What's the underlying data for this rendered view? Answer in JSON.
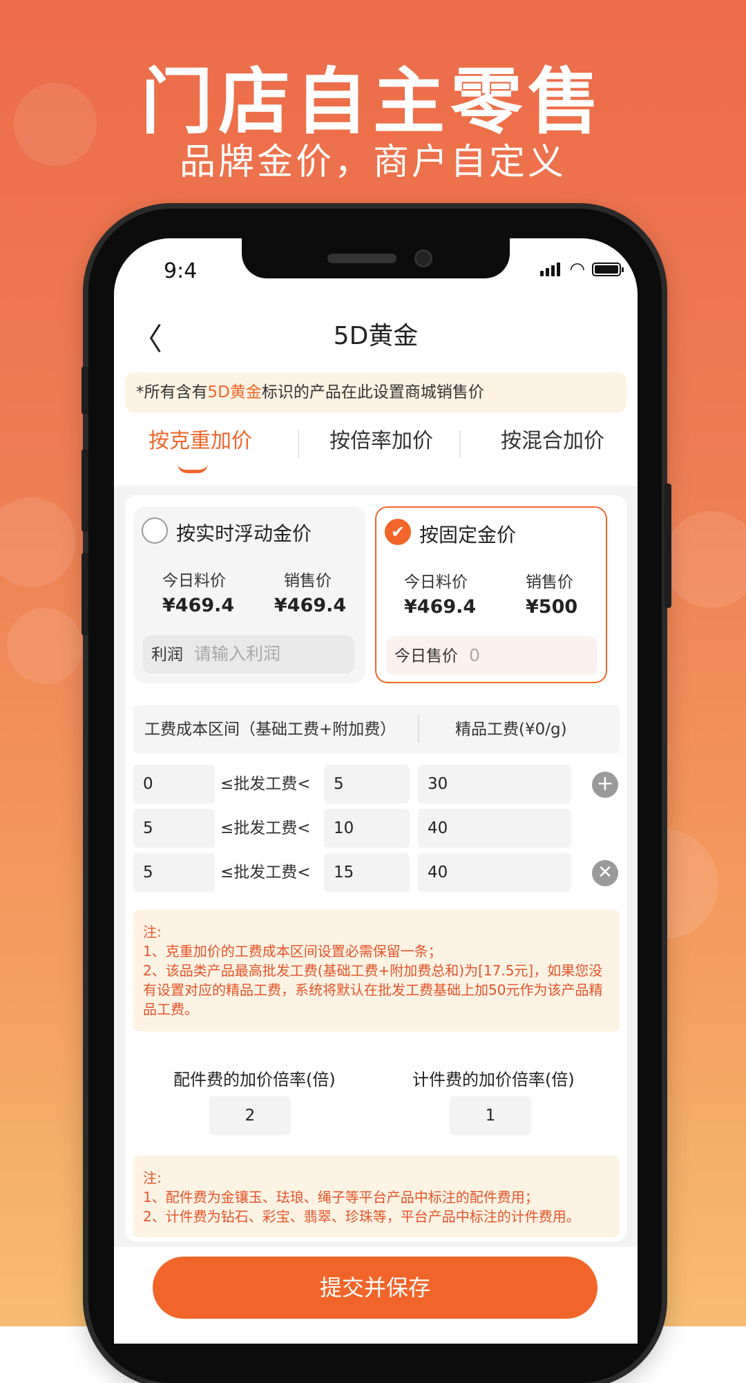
{
  "hero": {
    "title": "门店自主零售",
    "subtitle": "品牌金价，商户自定义"
  },
  "status_bar": {
    "time": "9:4"
  },
  "nav": {
    "title": "5D黄金"
  },
  "notice": {
    "prefix": "*所有含有",
    "highlight": "5D黄金",
    "suffix": "标识的产品在此设置商城销售价"
  },
  "tabs": [
    {
      "label": "按克重加价",
      "active": true
    },
    {
      "label": "按倍率加价",
      "active": false
    },
    {
      "label": "按混合加价",
      "active": false
    }
  ],
  "modes": {
    "floating": {
      "title": "按实时浮动金价",
      "checked": false,
      "material_label": "今日料价",
      "material_value": "¥469.4",
      "sale_label": "销售价",
      "sale_value": "¥469.4",
      "input_label": "利润",
      "input_placeholder": "请输入利润"
    },
    "fixed": {
      "title": "按固定金价",
      "checked": true,
      "material_label": "今日料价",
      "material_value": "¥469.4",
      "sale_label": "销售价",
      "sale_value": "¥500",
      "input_label": "今日售价",
      "input_value": "0"
    }
  },
  "fee_table": {
    "header_left": "工费成本区间（基础工费+附加费）",
    "header_right": "精品工费(¥0/g)",
    "separator": "≤批发工费<",
    "rows": [
      {
        "min": "0",
        "max": "5",
        "fee": "30",
        "action": "add"
      },
      {
        "min": "5",
        "max": "10",
        "fee": "40",
        "action": "none"
      },
      {
        "min": "5",
        "max": "15",
        "fee": "40",
        "action": "remove"
      }
    ]
  },
  "note1": {
    "title": "注:",
    "lines": [
      "1、克重加价的工费成本区间设置必需保留一条；",
      "2、该品类产品最高批发工费(基础工费+附加费总和)为[17.5元]，如果您没有设置对应的精品工费，系统将默认在批发工费基础上加50元作为该产品精品工费。"
    ]
  },
  "rates": {
    "accessory_label": "配件费的加价倍率(倍)",
    "accessory_value": "2",
    "piece_label": "计件费的加价倍率(倍)",
    "piece_value": "1"
  },
  "note2": {
    "title": "注:",
    "lines": [
      "1、配件费为金镶玉、珐琅、绳子等平台产品中标注的配件费用；",
      "2、计件费为钻石、彩宝、翡翠、珍珠等，平台产品中标注的计件费用。"
    ]
  },
  "submit_label": "提交并保存",
  "colors": {
    "accent": "#f2652a",
    "note_bg": "#fdf3e3",
    "note_text": "#e4542a"
  }
}
